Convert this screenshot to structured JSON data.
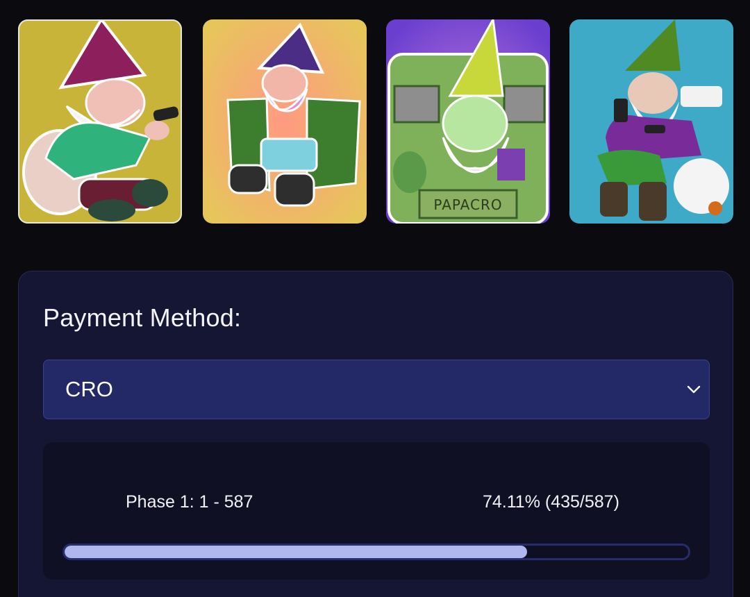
{
  "gallery": {
    "items": [
      {
        "name": "gnome-on-toilet-phone-yellow"
      },
      {
        "name": "gnome-flashing-coat-pink-beard"
      },
      {
        "name": "gnome-green-papacro-window",
        "caption": "PAPACRO"
      },
      {
        "name": "gnome-on-toilet-phone-blue"
      }
    ]
  },
  "payment": {
    "label": "Payment Method:",
    "selected": "CRO",
    "dropdown_icon": "chevron-down-icon"
  },
  "phase": {
    "label": "Phase 1: 1 - 587",
    "progress_text": "74.11% (435/587)",
    "minted": 435,
    "total": 587,
    "progress_fraction": 0.7411
  },
  "colors": {
    "page_background": "#0b0b0f",
    "panel_background": "#141633",
    "select_background": "#222966",
    "progress_fill": "#b0b6ee",
    "progress_track": "#272d6a"
  }
}
